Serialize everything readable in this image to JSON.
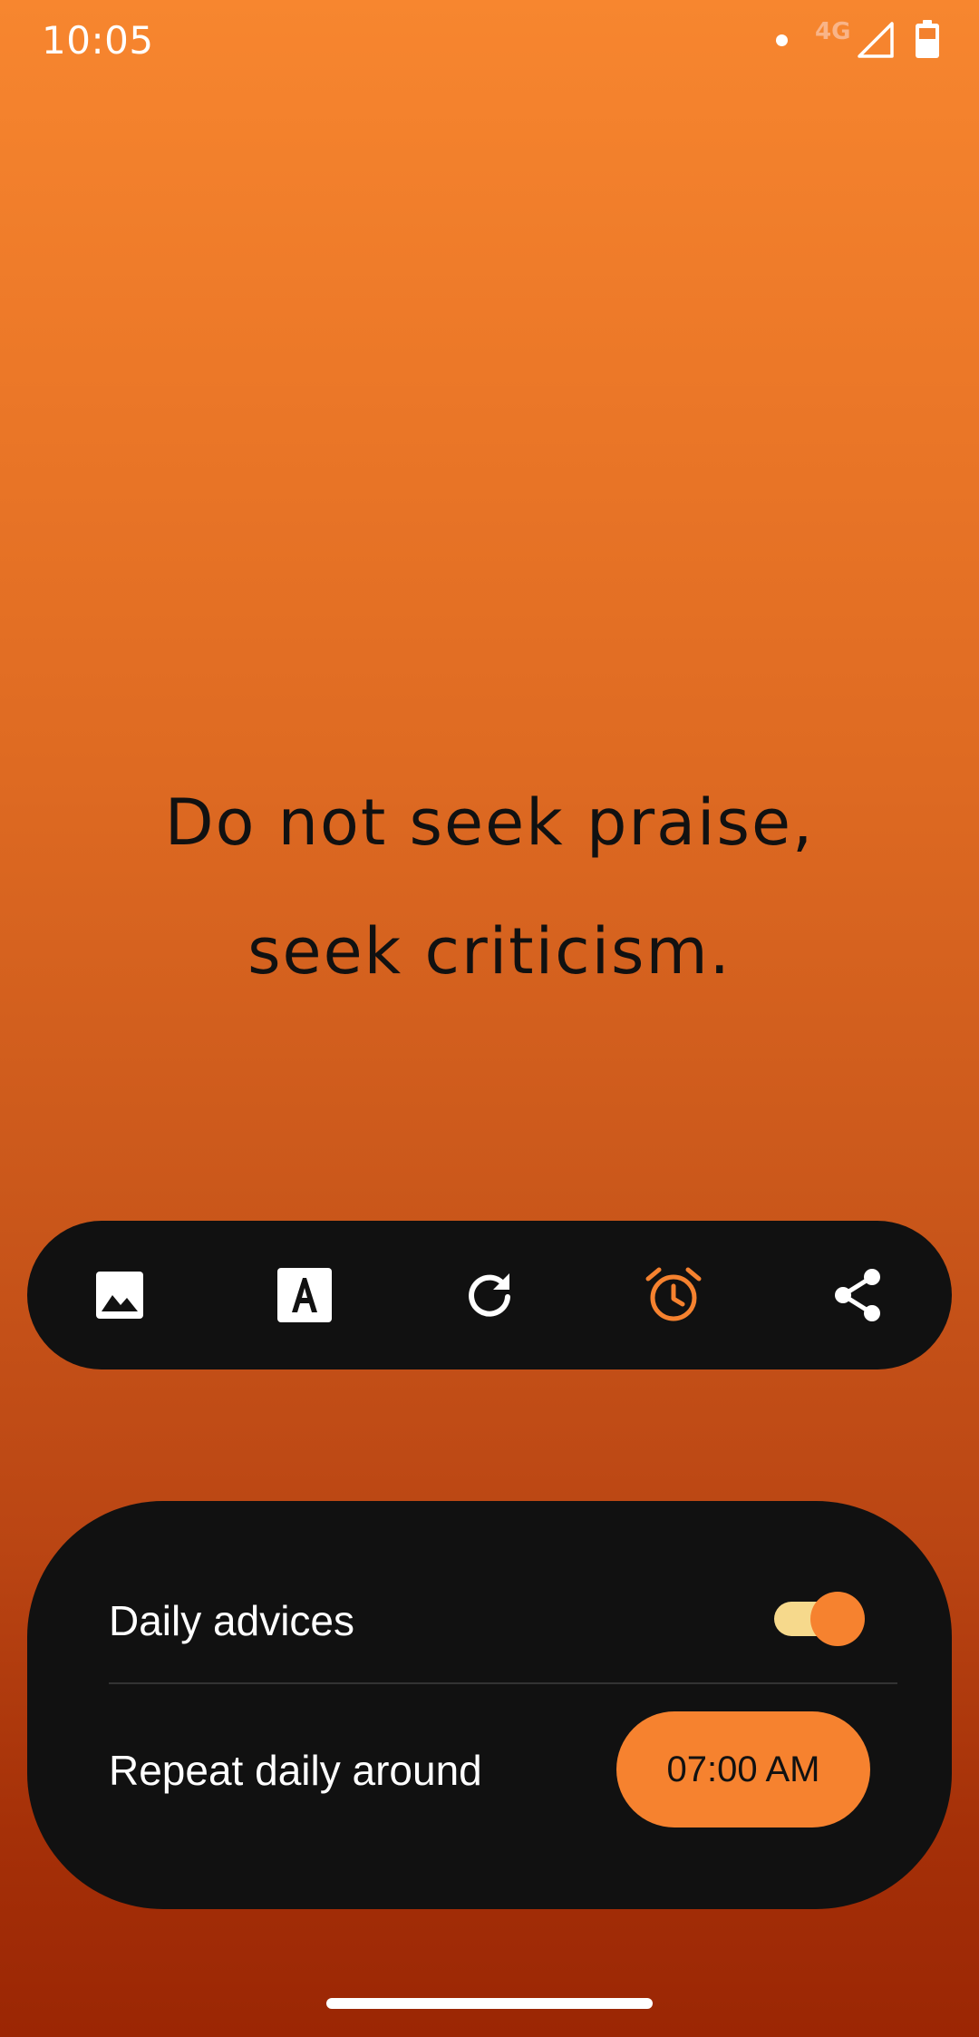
{
  "status_bar": {
    "time": "10:05",
    "network": "4G",
    "icons": [
      "notification-dot-icon",
      "cell-signal-icon",
      "battery-icon"
    ]
  },
  "quote": {
    "text": "Do not seek praise,\nseek criticism."
  },
  "toolbar": {
    "icons": [
      "image-icon",
      "font-icon",
      "refresh-icon",
      "alarm-clock-icon",
      "share-icon"
    ],
    "active_icon": "alarm-clock-icon",
    "active_color": "#F6822F",
    "icon_color": "#FFFFFF"
  },
  "settings": {
    "daily_label": "Daily advices",
    "daily_enabled": true,
    "repeat_label": "Repeat daily around",
    "time_value": "07:00 AM"
  },
  "colors": {
    "background_top": "#F7862F",
    "background_bottom": "#9B2604",
    "panel": "#111111",
    "accent": "#F6822F",
    "toggle_track": "#F6D98C"
  }
}
